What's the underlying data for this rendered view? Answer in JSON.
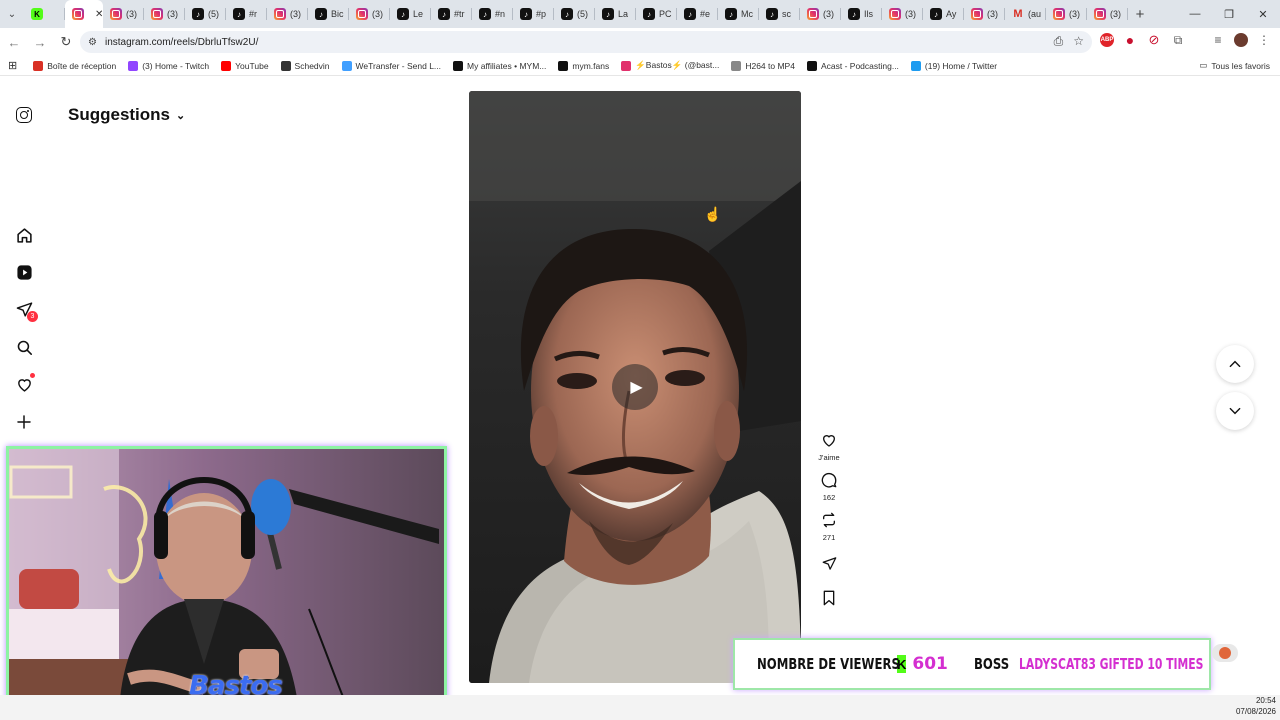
{
  "browser": {
    "tabs": [
      {
        "icon": "kick-icon",
        "label": ""
      },
      {
        "icon": "instagram-icon",
        "label": "",
        "active": true
      },
      {
        "icon": "instagram-icon",
        "label": "(3)"
      },
      {
        "icon": "instagram-icon",
        "label": "(3)"
      },
      {
        "icon": "tiktok-icon",
        "label": "(5)"
      },
      {
        "icon": "tiktok-icon",
        "label": "#r"
      },
      {
        "icon": "instagram-icon",
        "label": "(3)"
      },
      {
        "icon": "tiktok-icon",
        "label": "Bic"
      },
      {
        "icon": "instagram-icon",
        "label": "(3)"
      },
      {
        "icon": "tiktok-icon",
        "label": "Le"
      },
      {
        "icon": "tiktok-icon",
        "label": "#tr"
      },
      {
        "icon": "tiktok-icon",
        "label": "#n"
      },
      {
        "icon": "tiktok-icon",
        "label": "#p"
      },
      {
        "icon": "tiktok-icon",
        "label": "(5)"
      },
      {
        "icon": "tiktok-icon",
        "label": "La"
      },
      {
        "icon": "tiktok-icon",
        "label": "PC"
      },
      {
        "icon": "tiktok-icon",
        "label": "#e"
      },
      {
        "icon": "tiktok-icon",
        "label": "Mc"
      },
      {
        "icon": "tiktok-icon",
        "label": "sc"
      },
      {
        "icon": "instagram-icon",
        "label": "(3)"
      },
      {
        "icon": "tiktok-icon",
        "label": "Ils"
      },
      {
        "icon": "instagram-icon",
        "label": "(3)"
      },
      {
        "icon": "tiktok-icon",
        "label": "Ay"
      },
      {
        "icon": "instagram-icon",
        "label": "(3)"
      },
      {
        "icon": "gmail-icon",
        "label": "(au"
      },
      {
        "icon": "instagram-icon",
        "label": "(3)"
      },
      {
        "icon": "instagram-icon",
        "label": "(3)"
      }
    ],
    "url": "instagram.com/reels/DbrluTfsw2U/",
    "bookmarks": [
      {
        "label": "Boîte de réception",
        "color": "#d93025"
      },
      {
        "label": "(3) Home - Twitch",
        "color": "#9146ff"
      },
      {
        "label": "YouTube",
        "color": "#ff0000"
      },
      {
        "label": "Schedvin",
        "color": "#333333"
      },
      {
        "label": "WeTransfer - Send L...",
        "color": "#409fff"
      },
      {
        "label": "My affiliates • MYM...",
        "color": "#111111"
      },
      {
        "label": "mym.fans",
        "color": "#111111"
      },
      {
        "label": "⚡Bastos⚡ (@bast...",
        "color": "#e1306c"
      },
      {
        "label": "H264 to MP4",
        "color": "#888888"
      },
      {
        "label": "Acast - Podcasting...",
        "color": "#111111"
      },
      {
        "label": "(19) Home / Twitter",
        "color": "#1d9bf0"
      }
    ],
    "all_bookmarks_label": "Tous les favoris"
  },
  "instagram": {
    "header_title": "Suggestions",
    "notification_count": "3",
    "actions": {
      "like_label": "J'aime",
      "comments_count": "162",
      "reposts_count": "271"
    }
  },
  "overlay": {
    "webcam_logo": "Bastos",
    "banner": {
      "viewers_label": "NOMBRE DE VIEWERS",
      "viewers_count": "601",
      "boss_label": "BOSS",
      "gift_text": "LADYSCAT83 GIFTED 10 TIMES"
    }
  },
  "taskbar": {
    "time": "20:54",
    "date": "07/08/2026"
  },
  "colors": {
    "accent_instagram": "#e1306c",
    "kick_green": "#53fc18",
    "banner_pink": "#d42fd0",
    "notification_red": "#ff3040"
  }
}
